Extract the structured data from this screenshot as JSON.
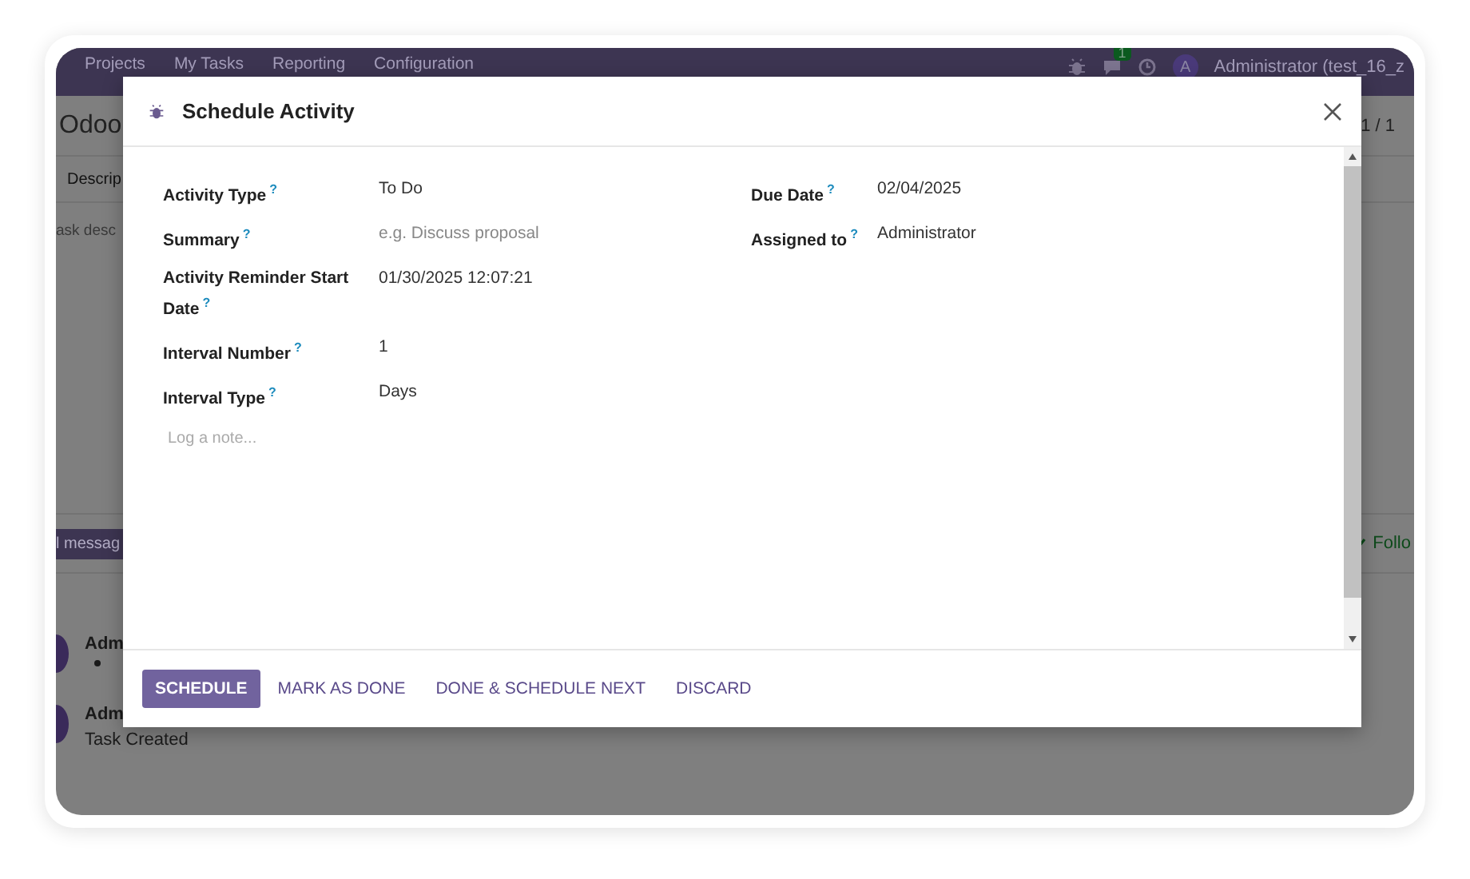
{
  "background": {
    "nav": {
      "menu": [
        "Projects",
        "My Tasks",
        "Reporting",
        "Configuration"
      ],
      "chat_badge": "1",
      "avatar": "A",
      "user": "Administrator (test_16_z"
    },
    "breadcrumb": "Odoo",
    "pager": "1 / 1",
    "tab": "Descrip",
    "description_placeholder": "ask desc",
    "send_button": "l messag",
    "follow_button": "Follo",
    "messages": [
      {
        "author": "Adm",
        "kind": "bullet"
      },
      {
        "author": "Adm",
        "body": "Task Created",
        "kind": "text"
      }
    ]
  },
  "dialog": {
    "title": "Schedule Activity",
    "left_fields": [
      {
        "label": "Activity Type",
        "hint": "?",
        "value": "To Do"
      },
      {
        "label": "Summary",
        "hint": "?",
        "placeholder": "e.g. Discuss proposal"
      },
      {
        "label": "Activity Reminder Start Date",
        "hint": "?",
        "value": "01/30/2025 12:07:21"
      },
      {
        "label": "Interval Number",
        "hint": "?",
        "value": "1"
      },
      {
        "label": "Interval Type",
        "hint": "?",
        "value": "Days"
      }
    ],
    "right_fields": [
      {
        "label": "Due Date",
        "hint": "?",
        "value": "02/04/2025"
      },
      {
        "label": "Assigned to",
        "hint": "?",
        "value": "Administrator"
      }
    ],
    "note": {
      "placeholder": "Log a note..."
    },
    "buttons": [
      {
        "label": "SCHEDULE",
        "primary": true
      },
      {
        "label": "MARK AS DONE",
        "primary": false
      },
      {
        "label": "DONE & SCHEDULE NEXT",
        "primary": false
      },
      {
        "label": "DISCARD",
        "primary": false
      }
    ]
  }
}
